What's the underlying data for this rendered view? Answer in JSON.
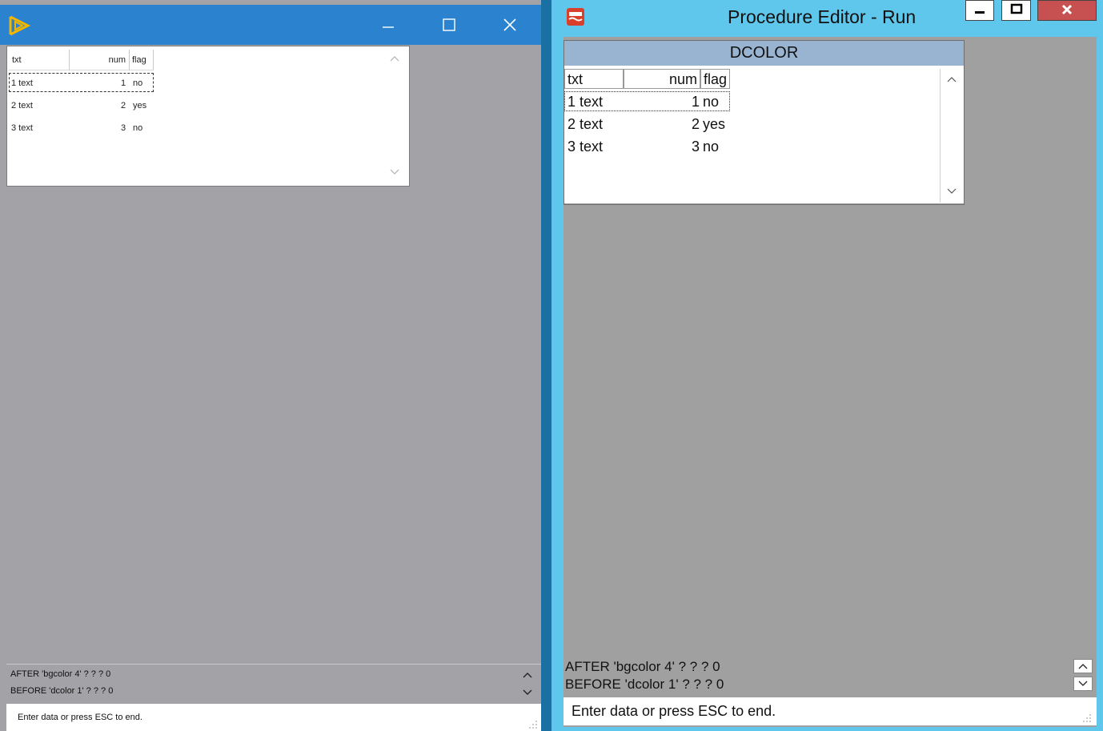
{
  "left_window": {
    "app_icon": "play-triangle-icon",
    "browse": {
      "columns": [
        "txt",
        "num",
        "flag"
      ],
      "rows": [
        {
          "txt": "1 text",
          "num": "1",
          "flag": "no"
        },
        {
          "txt": "2 text",
          "num": "2",
          "flag": "yes"
        },
        {
          "txt": "3 text",
          "num": "3",
          "flag": "no"
        }
      ]
    },
    "messages": [
      "AFTER 'bgcolor 4' ? ? ? 0",
      "BEFORE 'dcolor 1' ? ? ? 0"
    ],
    "status": "Enter data or press ESC to end."
  },
  "right_window": {
    "title": "Procedure Editor - Run",
    "frame_title": "DCOLOR",
    "browse": {
      "columns": [
        "txt",
        "num",
        "flag"
      ],
      "rows": [
        {
          "txt": "1 text",
          "num": "1",
          "flag": "no"
        },
        {
          "txt": "2 text",
          "num": "2",
          "flag": "yes"
        },
        {
          "txt": "3 text",
          "num": "3",
          "flag": "no"
        }
      ]
    },
    "messages": [
      "AFTER 'bgcolor 4' ? ? ? 0",
      "BEFORE 'dcolor 1' ? ? ? 0"
    ],
    "status": "Enter data or press ESC to end.",
    "buttons": {
      "minimize": "–",
      "maximize": "☐",
      "close": "X"
    }
  },
  "colors": {
    "left_titlebar": "#2b83d0",
    "right_titlebar": "#60c7ec",
    "right_frame_header": "#99b4d1",
    "close_button": "#c75050"
  }
}
